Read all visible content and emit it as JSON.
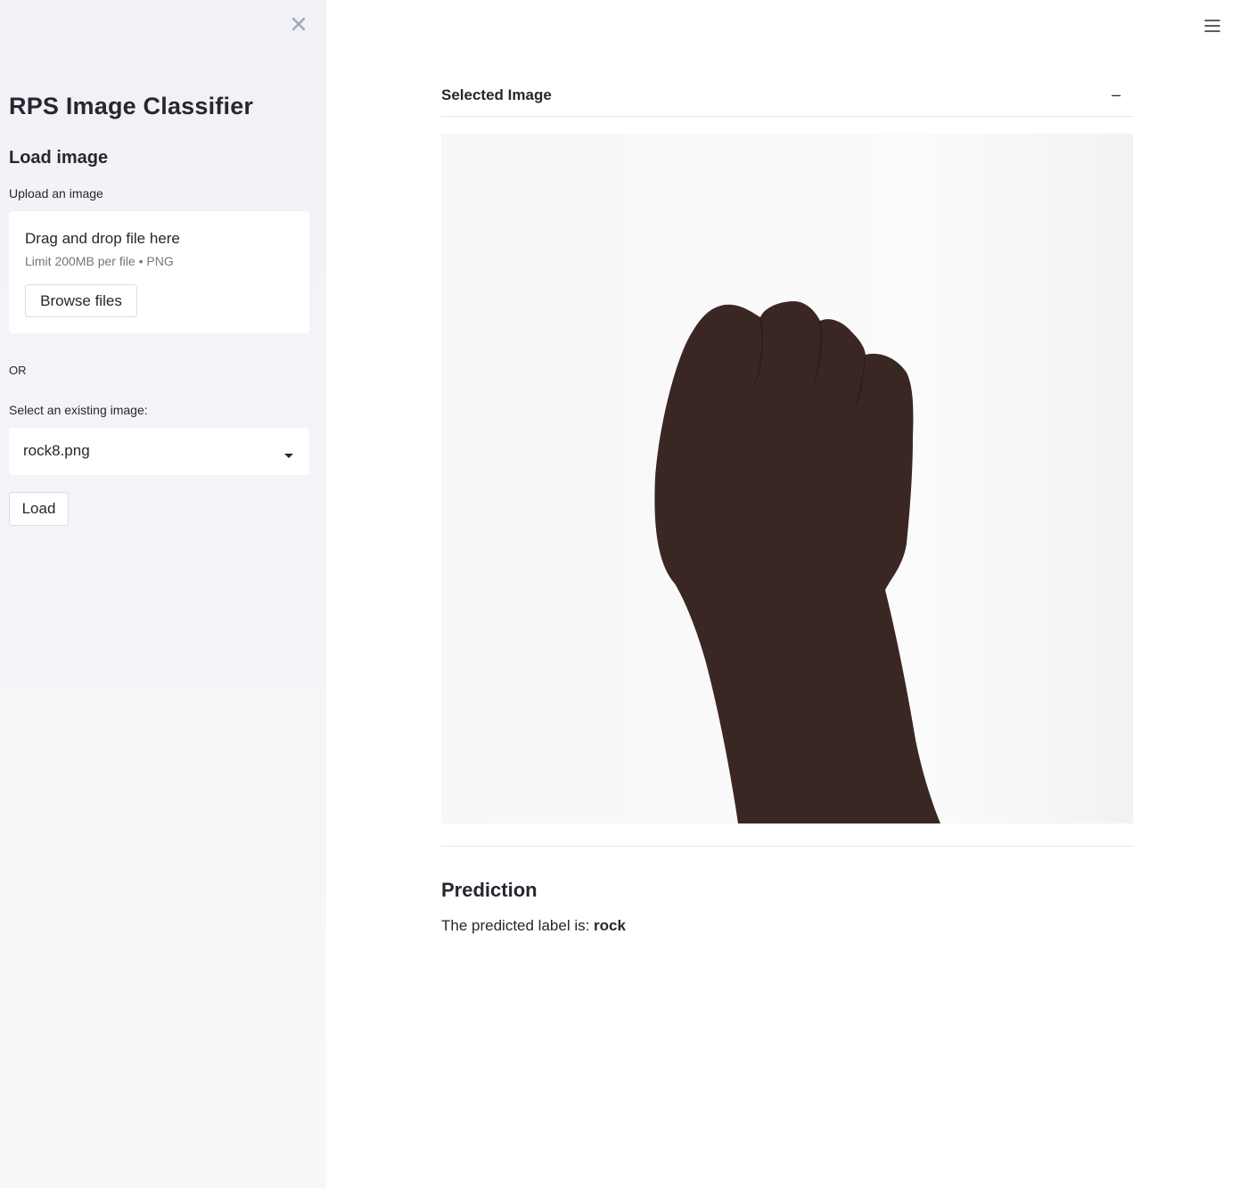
{
  "sidebar": {
    "title": "RPS Image Classifier",
    "section_heading": "Load image",
    "upload_label": "Upload an image",
    "uploader": {
      "title": "Drag and drop file here",
      "limit": "Limit 200MB per file • PNG",
      "browse_label": "Browse files"
    },
    "or_text": "OR",
    "select_label": "Select an existing image:",
    "select_value": "rock8.png",
    "load_label": "Load",
    "close_icon": "close-icon"
  },
  "main": {
    "menu_icon": "hamburger-menu-icon",
    "expander": {
      "title": "Selected Image",
      "toggle": "–",
      "image_description": "hand-fist-image"
    },
    "prediction": {
      "heading": "Prediction",
      "text_prefix": "The predicted label is: ",
      "label": "rock"
    }
  },
  "colors": {
    "sidebar_bg": "#f0f2f6",
    "text": "#262730",
    "muted_text": "#73757c",
    "hand": "#3a2723"
  }
}
